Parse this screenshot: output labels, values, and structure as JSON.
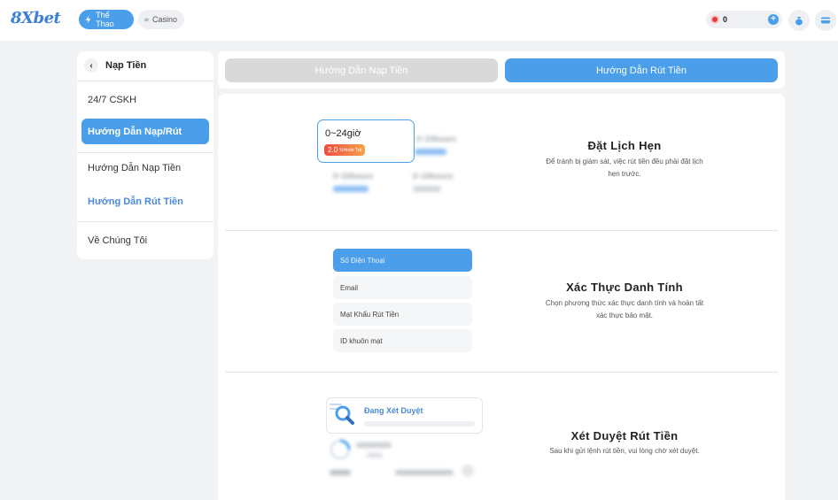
{
  "header": {
    "logo": "8Xbet",
    "nav": [
      {
        "label": "Thể Thao",
        "icon": "lightning-icon",
        "active": true
      },
      {
        "label": "Casino",
        "icon": "cloud-icon",
        "active": false
      }
    ],
    "balance": "0",
    "accent": "#4a9eea"
  },
  "sidebar": {
    "title": "Nạp Tiền",
    "items": [
      {
        "label": "24/7 CSKH"
      },
      {
        "label": "Hướng Dẫn Nạp/Rút",
        "active": true
      },
      {
        "label": "Hướng Dẫn Nạp Tiền"
      },
      {
        "label": "Hướng Dẫn Rút Tiền",
        "highlight": true
      },
      {
        "label": "Về Chúng Tôi"
      }
    ]
  },
  "tabs": [
    {
      "label": "Hướng Dẫn Nạp Tiền",
      "active": false
    },
    {
      "label": "Hướng Dẫn Rút Tiền",
      "active": true
    }
  ],
  "steps": [
    {
      "title": "Đặt Lịch Hẹn",
      "desc_line1": "Để tránh bị giám sát, việc rút tiền đều phải đặt lịch",
      "desc_line2": "hẹn trước.",
      "card_time": "0~24giờ",
      "badge_value": "2.0",
      "badge_label": "%Hoàn Trả",
      "blurred": [
        "0~24hours",
        "0~24hours",
        "0~24hours"
      ]
    },
    {
      "title": "Xác Thực Danh Tính",
      "desc_line1": "Chọn phương thức xác thực danh tính và hoàn tất",
      "desc_line2": "xác thực bảo mật.",
      "options": [
        "Số Điện Thoại",
        "Email",
        "Mạt Khẩu Rút Tiền",
        "ID khuôn mạt"
      ]
    },
    {
      "title": "Xét Duyệt Rút Tiền",
      "desc_line1": "Sau khi gửi lệnh rút tiền, vui lòng chờ xét duyệt.",
      "review_label": "Đang Xét Duyệt"
    }
  ]
}
